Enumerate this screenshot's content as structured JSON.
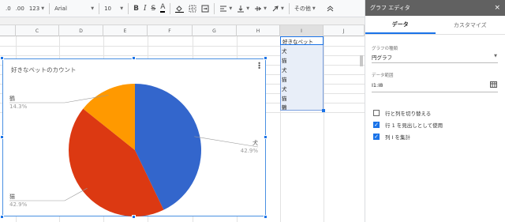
{
  "toolbar": {
    "undo_icon": "paint-format-icon",
    "percent_icon": "decimal-icon",
    "number_format": "123",
    "font": "Arial",
    "font_size": "10",
    "bold": "B",
    "italic": "I",
    "strike": "S",
    "text_color": "A",
    "more": "その他"
  },
  "columns": [
    "C",
    "D",
    "E",
    "F",
    "G",
    "H",
    "I",
    "J"
  ],
  "cells": [
    "好きなペット",
    "犬",
    "猫",
    "犬",
    "猫",
    "犬",
    "猫",
    "鶴"
  ],
  "chart": {
    "title": "好きなペットのカウント",
    "slice_labels": [
      {
        "name": "犬",
        "pct": "42.9%"
      },
      {
        "name": "猫",
        "pct": "42.9%"
      },
      {
        "name": "鶴",
        "pct": "14.3%"
      }
    ],
    "colors": {
      "dog": "#3366cc",
      "cat": "#dc3912",
      "crane": "#ff9900"
    }
  },
  "chart_data": {
    "type": "pie",
    "title": "好きなペットのカウント",
    "categories": [
      "犬",
      "猫",
      "鶴"
    ],
    "values": [
      3,
      3,
      1
    ],
    "percent_labels": [
      "42.9%",
      "42.9%",
      "14.3%"
    ]
  },
  "editor": {
    "title": "グラフ エディタ",
    "close": "×",
    "tab_data": "データ",
    "tab_custom": "カスタマイズ",
    "chart_type_label": "グラフの種類",
    "chart_type_value": "円グラフ",
    "range_label": "データ範囲",
    "range_value": "I1:I8",
    "opt_switch": "行と列を切り替える",
    "opt_header": "行 1 を見出しとして使用",
    "opt_aggregate": "列 I を集計"
  }
}
